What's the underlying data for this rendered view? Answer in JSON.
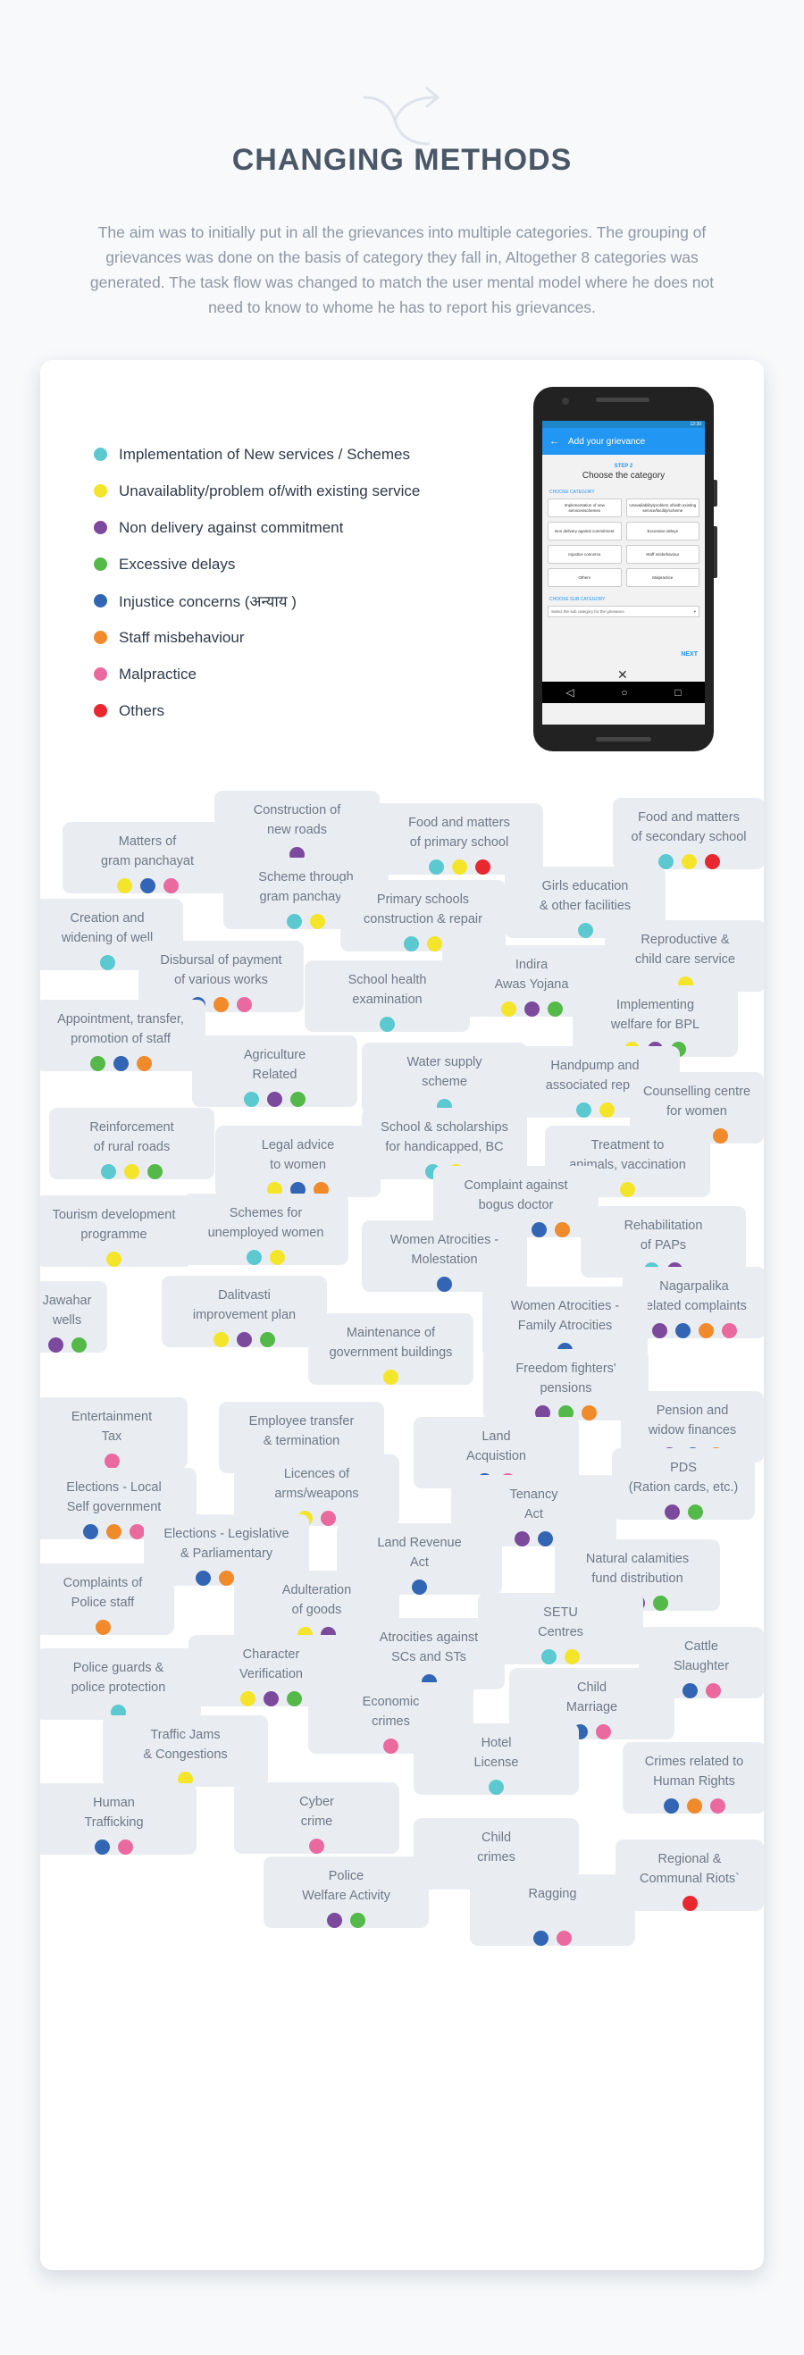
{
  "page": {
    "title": "CHANGING METHODS",
    "description": "The aim was to initially put in all the grievances into multiple categories. The grouping of grievances was done on the basis of category they fall in, Altogether 8 categories was generated. The task flow was changed to match the user mental model where he does not need to know to whome he has to report his grievances.",
    "header_icon": "split-arrows-icon"
  },
  "colors": {
    "teal": "#5cc9d1",
    "yellow": "#f4e52a",
    "purple": "#7c4a9c",
    "green": "#54b948",
    "blue": "#3266b4",
    "orange": "#f08a2b",
    "pink": "#ea6aa0",
    "red": "#e8282e"
  },
  "legend": [
    {
      "label": "Implementation of  New services / Schemes",
      "color": "teal"
    },
    {
      "label": "Unavailablity/problem of/with existing service",
      "color": "yellow"
    },
    {
      "label": "Non delivery against commitment",
      "color": "purple"
    },
    {
      "label": "Excessive delays",
      "color": "green"
    },
    {
      "label": "Injustice concerns (अन्याय )",
      "color": "blue"
    },
    {
      "label": "Staff misbehaviour",
      "color": "orange"
    },
    {
      "label": "Malpractice",
      "color": "pink"
    },
    {
      "label": "Others",
      "color": "red"
    }
  ],
  "phone": {
    "status": "12:30",
    "title": "Add your grievance",
    "step": "STEP 2",
    "heading": "Choose the category",
    "section_label": "CHOOSE CATEGORY",
    "options": [
      "Implementation of new services/schemes",
      "Unavailability/problem of/with existing service/facility/scheme",
      "Non delivery against commitment",
      "Excessive delays",
      "Injustice concerns",
      "Staff misbehaviour",
      "Others",
      "Malpractice"
    ],
    "sub_label": "CHOOSE SUB CATEGORY",
    "sub_placeholder": "Select the sub category for the grievance",
    "next": "NEXT",
    "close": "✕",
    "nav": [
      "◁",
      "○",
      "□"
    ]
  },
  "issues": [
    {
      "label": "Construction of\nnew roads",
      "dots": [
        "purple"
      ]
    },
    {
      "label": "Food and matters\nof primary school",
      "dots": [
        "teal",
        "yellow",
        "red"
      ]
    },
    {
      "label": "Food and matters\nof secondary school",
      "dots": [
        "teal",
        "yellow",
        "red"
      ]
    },
    {
      "label": "Matters of\ngram panchayat",
      "dots": [
        "yellow",
        "blue",
        "pink"
      ]
    },
    {
      "label": "Scheme through\ngram panchayat",
      "dots": [
        "teal",
        "yellow"
      ]
    },
    {
      "label": "Girls education\n& other facilities",
      "dots": [
        "teal"
      ]
    },
    {
      "label": "Creation and\nwidening of well",
      "dots": [
        "teal"
      ]
    },
    {
      "label": "Primary schools\nconstruction & repair",
      "dots": [
        "teal",
        "yellow"
      ]
    },
    {
      "label": "Reproductive &\nchild care service",
      "dots": [
        "yellow"
      ]
    },
    {
      "label": "Disbursal of payment\nof various works",
      "dots": [
        "blue",
        "orange",
        "pink"
      ]
    },
    {
      "label": "Indira\nAwas Yojana",
      "dots": [
        "yellow",
        "purple",
        "green"
      ]
    },
    {
      "label": "School health\nexamination",
      "dots": [
        "teal"
      ]
    },
    {
      "label": "Implementing\nwelfare for BPL",
      "dots": [
        "yellow",
        "purple",
        "green"
      ]
    },
    {
      "label": "Appointment, transfer,\npromotion of staff",
      "dots": [
        "green",
        "blue",
        "orange"
      ]
    },
    {
      "label": "Agriculture\nRelated",
      "dots": [
        "teal",
        "purple",
        "green"
      ]
    },
    {
      "label": "Water supply\nscheme",
      "dots": [
        "teal"
      ]
    },
    {
      "label": "Handpump and\nassociated repair",
      "dots": [
        "teal",
        "yellow"
      ]
    },
    {
      "label": "Counselling centre\nfor women",
      "dots": [
        "teal",
        "yellow",
        "orange"
      ]
    },
    {
      "label": "Reinforcement\nof rural roads",
      "dots": [
        "teal",
        "yellow",
        "green"
      ]
    },
    {
      "label": "Legal advice\nto women",
      "dots": [
        "yellow",
        "blue",
        "orange"
      ]
    },
    {
      "label": "School & scholarships\nfor handicapped, BC",
      "dots": [
        "teal",
        "yellow"
      ]
    },
    {
      "label": "Treatment to\nanimals, vaccination",
      "dots": [
        "yellow"
      ]
    },
    {
      "label": "Complaint against\nbogus doctor",
      "dots": [
        "yellow",
        "purple",
        "green",
        "blue",
        "orange"
      ]
    },
    {
      "label": "Tourism development\nprogramme",
      "dots": [
        "yellow"
      ]
    },
    {
      "label": "Schemes for\nunemployed women",
      "dots": [
        "teal",
        "yellow"
      ]
    },
    {
      "label": "Rehabilitation\nof PAPs",
      "dots": [
        "teal",
        "purple"
      ]
    },
    {
      "label": "Women Atrocities -\nMolestation",
      "dots": [
        "blue"
      ]
    },
    {
      "label": "Nagarpalika\nrelated complaints",
      "dots": [
        "purple",
        "blue",
        "orange",
        "pink"
      ]
    },
    {
      "label": "Jawahar\nwells",
      "dots": [
        "purple",
        "green"
      ]
    },
    {
      "label": "Dalitvasti\nimprovement plan",
      "dots": [
        "yellow",
        "purple",
        "green"
      ]
    },
    {
      "label": "Women Atrocities -\nFamily Atrocities",
      "dots": [
        "blue"
      ]
    },
    {
      "label": "Maintenance of\ngovernment buildings",
      "dots": [
        "yellow"
      ]
    },
    {
      "label": "Freedom fighters'\npensions",
      "dots": [
        "purple",
        "green",
        "orange"
      ]
    },
    {
      "label": "Entertainment\nTax",
      "dots": [
        "pink"
      ]
    },
    {
      "label": "Pension and\nwidow finances",
      "dots": [
        "purple",
        "blue",
        "orange"
      ]
    },
    {
      "label": "Employee transfer\n& termination",
      "dots": [
        "blue",
        "orange",
        "pink"
      ]
    },
    {
      "label": "Land\nAcquistion",
      "dots": [
        "blue",
        "pink"
      ]
    },
    {
      "label": "PDS\n(Ration cards, etc.)",
      "dots": [
        "purple",
        "green"
      ]
    },
    {
      "label": "Elections - Local\nSelf government",
      "dots": [
        "blue",
        "orange",
        "pink"
      ]
    },
    {
      "label": "Licences of\narms/weapons",
      "dots": [
        "yellow",
        "pink"
      ]
    },
    {
      "label": "Tenancy\nAct",
      "dots": [
        "purple",
        "blue"
      ]
    },
    {
      "label": "Elections - Legislative\n& Parliamentary",
      "dots": [
        "blue",
        "orange",
        "pink"
      ]
    },
    {
      "label": "Land Revenue\nAct",
      "dots": [
        "blue"
      ]
    },
    {
      "label": "Natural calamities\nfund distribution",
      "dots": [
        "teal",
        "purple",
        "green"
      ]
    },
    {
      "label": "Complaints of\nPolice staff",
      "dots": [
        "orange"
      ]
    },
    {
      "label": "Adulteration\nof goods",
      "dots": [
        "yellow",
        "purple"
      ]
    },
    {
      "label": "SETU\nCentres",
      "dots": [
        "teal",
        "yellow"
      ]
    },
    {
      "label": "Atrocities against\nSCs and STs",
      "dots": [
        "blue"
      ]
    },
    {
      "label": "Cattle\nSlaughter",
      "dots": [
        "blue",
        "pink"
      ]
    },
    {
      "label": "Police guards &\npolice protection",
      "dots": [
        "teal"
      ]
    },
    {
      "label": "Character\nVerification",
      "dots": [
        "yellow",
        "purple",
        "green"
      ]
    },
    {
      "label": "Child\nMarriage",
      "dots": [
        "blue",
        "pink"
      ]
    },
    {
      "label": "Economic\ncrimes",
      "dots": [
        "pink"
      ]
    },
    {
      "label": "Traffic Jams\n& Congestions",
      "dots": [
        "yellow"
      ]
    },
    {
      "label": "Hotel\nLicense",
      "dots": [
        "teal"
      ]
    },
    {
      "label": "Crimes related to\nHuman Rights",
      "dots": [
        "blue",
        "orange",
        "pink"
      ]
    },
    {
      "label": "Cyber\ncrime",
      "dots": [
        "pink"
      ]
    },
    {
      "label": "Human\nTrafficking",
      "dots": [
        "blue",
        "pink"
      ]
    },
    {
      "label": "Child\ncrimes",
      "dots": [
        "blue",
        "pink"
      ]
    },
    {
      "label": "Regional &\nCommunal Riots`",
      "dots": [
        "red"
      ]
    },
    {
      "label": "Police\nWelfare Activity",
      "dots": [
        "purple",
        "green"
      ]
    },
    {
      "label": "Ragging",
      "dots": [
        "blue",
        "pink"
      ]
    }
  ]
}
